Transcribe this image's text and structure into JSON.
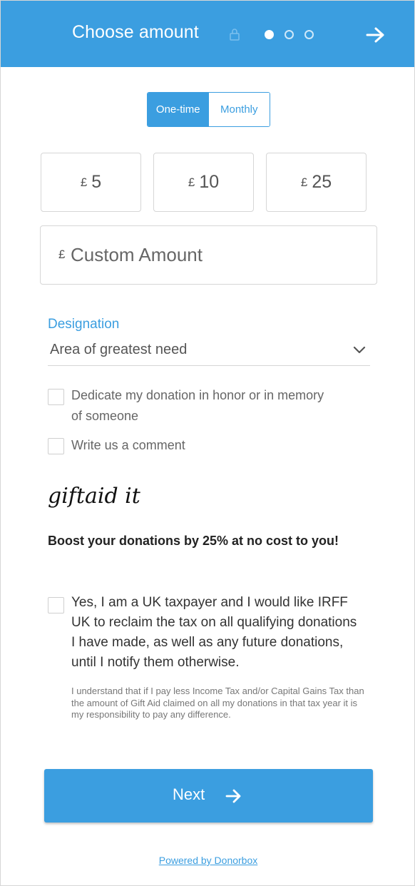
{
  "header": {
    "title": "Choose amount",
    "icons": {
      "lock": "lock-icon",
      "next": "arrow-right-icon"
    },
    "steps": {
      "total": 3,
      "current": 1
    }
  },
  "frequency": {
    "one_time": "One-time",
    "monthly": "Monthly",
    "selected": "One-time"
  },
  "amounts": [
    {
      "currency": "£",
      "value": "5"
    },
    {
      "currency": "£",
      "value": "10"
    },
    {
      "currency": "£",
      "value": "25"
    }
  ],
  "custom_amount": {
    "currency": "£",
    "placeholder": "Custom Amount"
  },
  "designation": {
    "label": "Designation",
    "value": "Area of greatest need"
  },
  "options": {
    "dedicate": {
      "line1": "Dedicate my donation in honor or in memory",
      "line2": "of someone"
    },
    "comment": "Write us a comment"
  },
  "gift_aid": {
    "logo_text": "giftaid it",
    "boost": "Boost your donations by 25% at no cost to you!",
    "taxpayer": "Yes, I am a UK taxpayer and I would like IRFF UK to reclaim the tax on all qualifying donations I have made, as well as any future donations, until I notify them otherwise.",
    "disclaimer": "I understand that if I pay less Income Tax and/or Capital Gains Tax than the amount of Gift Aid claimed on all my donations in that tax year it is my responsibility to pay any difference."
  },
  "next_button": {
    "label": "Next"
  },
  "footer": {
    "powered_by": "Powered by Donorbox"
  },
  "colors": {
    "accent": "#3b9ee0",
    "border": "#d6d6d6",
    "text": "#555555"
  }
}
